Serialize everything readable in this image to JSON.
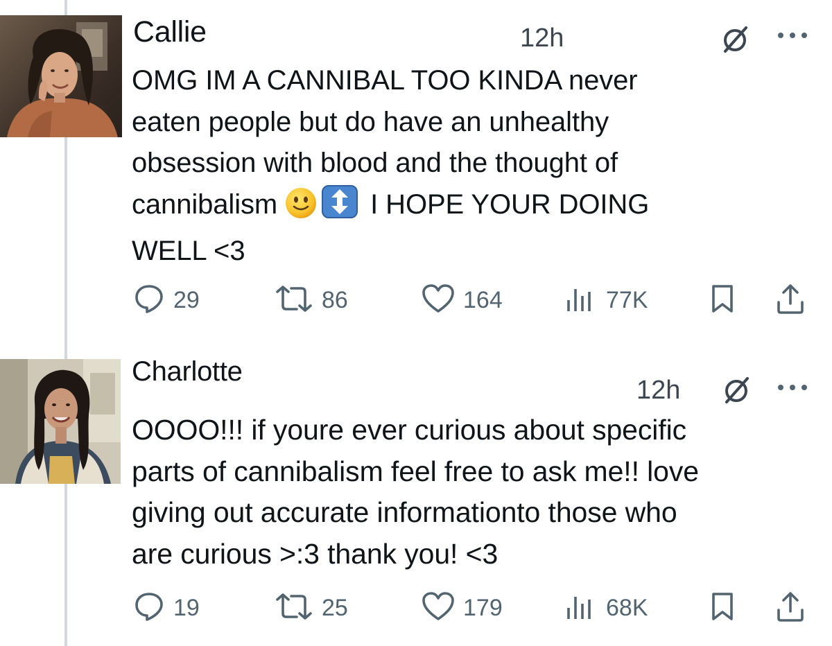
{
  "tweets": [
    {
      "name": "Callie",
      "time": "12h",
      "text_before_emoji": "OMG IM A CANNIBAL TOO KINDA never\neaten people but do have an unhealthy\nobsession with blood and the thought of\ncannibalism ",
      "text_after_emoji": " I HOPE YOUR DOING\nWELL <3",
      "emojis": [
        "slightly-smiling-face-emoji",
        "up-down-arrow-emoji"
      ],
      "replies": "29",
      "reposts": "86",
      "likes": "164",
      "views": "77K"
    },
    {
      "name": "Charlotte",
      "time": "12h",
      "text": "OOOO!!! if youre ever curious about specific\nparts of cannibalism feel free to ask me!! love\ngiving out accurate informationto those who\nare curious >:3 thank you! <3",
      "replies": "19",
      "reposts": "25",
      "likes": "179",
      "views": "68K"
    }
  ],
  "icons": {
    "reply": "speech-bubble-icon",
    "repost": "repost-arrows-icon",
    "like": "heart-icon",
    "views": "bar-chart-icon",
    "bookmark": "bookmark-icon",
    "share": "share-upload-icon",
    "grok": "grok-slash-circle-icon",
    "more": "more-dots-icon"
  },
  "colors": {
    "icon_gray": "#536471",
    "thread_line": "#cfd9de",
    "text": "#0f1419"
  }
}
